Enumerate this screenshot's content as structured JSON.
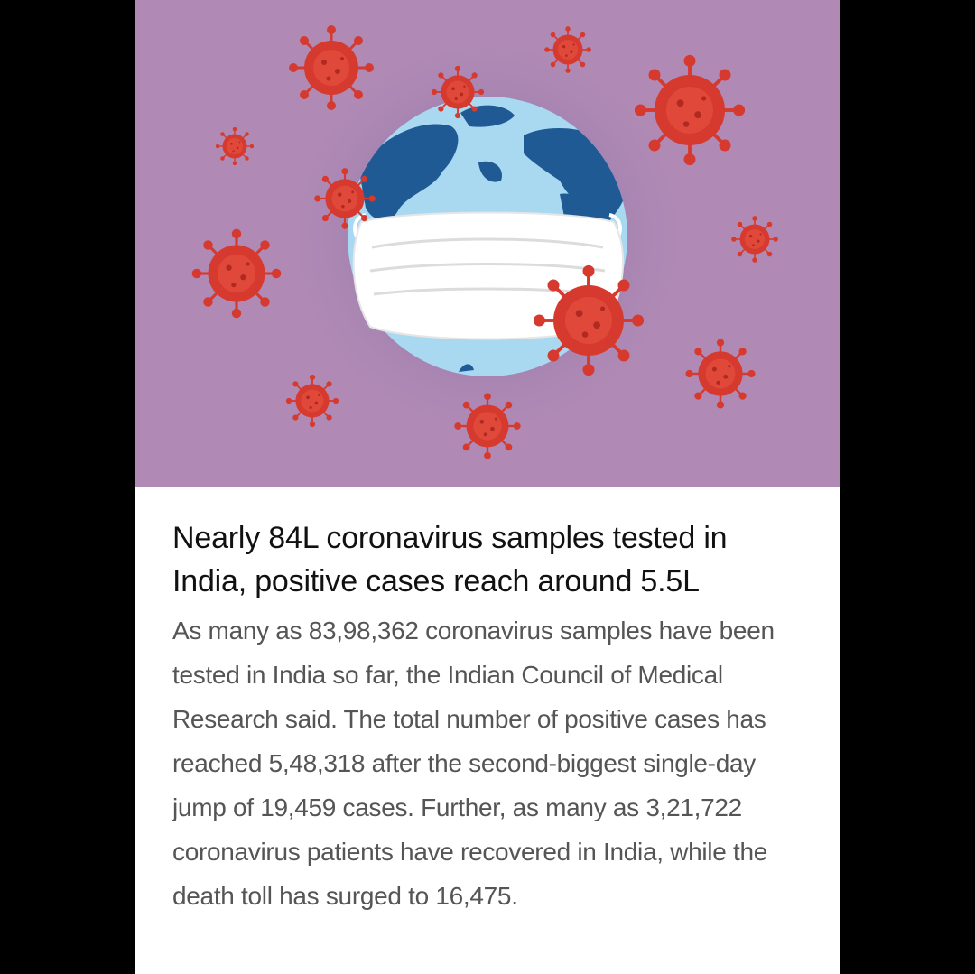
{
  "colors": {
    "page_background": "#000000",
    "card_background": "#ffffff",
    "hero_background": "#b08ab5",
    "virus": "#d63a2f",
    "globe_ocean": "#a9d8f1",
    "globe_land": "#1f5a94",
    "mask": "#ffffff"
  },
  "hero": {
    "image_description_icon": "globe-with-face-mask-and-virus-icons"
  },
  "article": {
    "headline": "Nearly 84L coronavirus samples tested in India, positive cases reach around 5.5L",
    "summary": "As many as 83,98,362 coronavirus samples have been tested in India so far, the Indian Council of Medical Research said. The total number of positive cases has reached 5,48,318 after the second-biggest single-day jump of 19,459 cases. Further, as many as 3,21,722 coronavirus patients have recovered in India, while the death toll has surged to 16,475."
  }
}
